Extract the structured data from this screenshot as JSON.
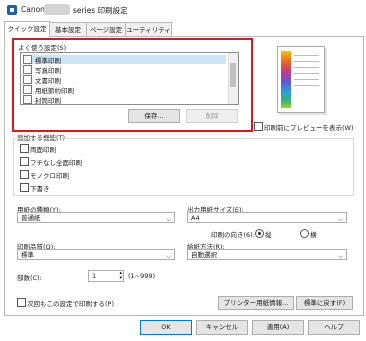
{
  "window": {
    "title_prefix": "Canon",
    "title_suffix": "series 印刷設定"
  },
  "tabs": [
    {
      "label": "クイック設定"
    },
    {
      "label": "基本設定"
    },
    {
      "label": "ページ設定"
    },
    {
      "label": "ユーティリティ"
    }
  ],
  "favorites": {
    "label": "よく使う設定(S)",
    "items": [
      {
        "label": "標準印刷",
        "selected": true
      },
      {
        "label": "写真印刷",
        "selected": false
      },
      {
        "label": "文書印刷",
        "selected": false
      },
      {
        "label": "用紙節約印刷",
        "selected": false
      },
      {
        "label": "封筒印刷",
        "selected": false
      }
    ],
    "save_label": "保存...",
    "delete_label": "削除"
  },
  "preview_checkbox": "印刷前にプレビューを表示(W)",
  "additional": {
    "label": "追加する機能(T)",
    "items": [
      {
        "label": "両面印刷"
      },
      {
        "label": "フチなし全面印刷"
      },
      {
        "label": "モノクロ印刷"
      },
      {
        "label": "下書き"
      }
    ]
  },
  "media_type": {
    "label": "用紙の種類(Y):",
    "value": "普通紙"
  },
  "paper_size": {
    "label": "出力用紙サイズ(E):",
    "value": "A4"
  },
  "orientation": {
    "label": "印刷の向き(6):",
    "portrait": "縦",
    "landscape": "横",
    "selected": "縦"
  },
  "quality": {
    "label": "印刷品質(Q):",
    "value": "標準"
  },
  "paper_source": {
    "label": "給紙方法(R):",
    "value": "自動選択"
  },
  "copies": {
    "label": "部数(C):",
    "value": "1",
    "range": "(1~999)"
  },
  "always_print_checkbox": "次回もこの設定で印刷する(P)",
  "printer_paper_info": "プリンター用紙情報...",
  "defaults_button": "標準に戻す(F)",
  "footer": {
    "ok": "OK",
    "cancel": "キャンセル",
    "apply": "適用(A)",
    "help": "ヘルプ"
  }
}
